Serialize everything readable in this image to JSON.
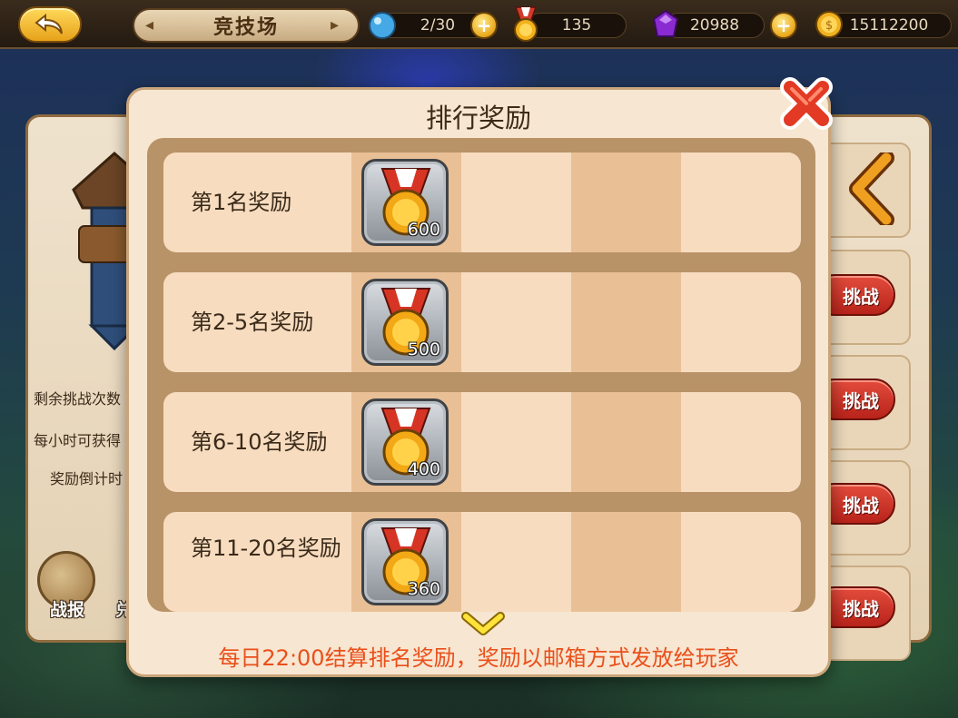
{
  "topbar": {
    "title": "竞技场",
    "stamina": "2/30",
    "medals": "135",
    "gems": "20988",
    "gold": "15112200"
  },
  "left_panel": {
    "line1": "剩余挑战次数",
    "line2": "每小时可获得",
    "line3": "奖励倒计时",
    "report_label": "战报",
    "second_label": "兑"
  },
  "right_panel": {
    "challenge_label": "挑战"
  },
  "modal": {
    "title": "排行奖励",
    "rows": [
      {
        "label": "第1名奖励",
        "count": "600"
      },
      {
        "label": "第2-5名奖励",
        "count": "500"
      },
      {
        "label": "第6-10名奖励",
        "count": "400"
      },
      {
        "label": "第11-20名奖励",
        "count": "360"
      }
    ],
    "footer": "每日22:00结算排名奖励，奖励以邮箱方式发放给玩家"
  },
  "colors": {
    "footer_text": "#ea4f1a",
    "modal_bg": "#f7e6d1",
    "challenge_btn": "#c8302a"
  },
  "icons": {
    "back": "back-arrow-icon",
    "stamina": "water-drop-icon",
    "medal": "medal-icon",
    "gem": "purple-gem-icon",
    "gold": "gold-coin-icon",
    "close": "close-x-icon"
  }
}
